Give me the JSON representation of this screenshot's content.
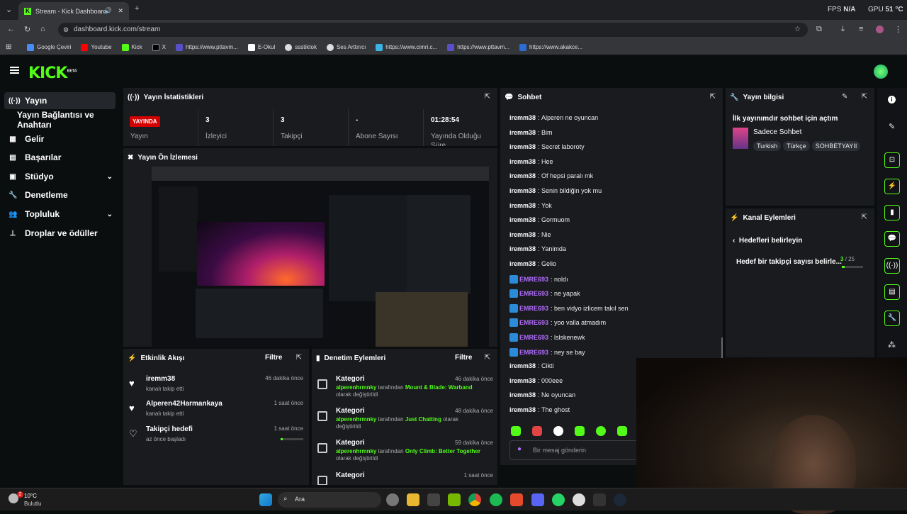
{
  "browser": {
    "tab_title": "Stream - Kick Dashboard",
    "url": "dashboard.kick.com/stream",
    "fps_label": "FPS",
    "fps_value": "N/A",
    "gpu_label": "GPU",
    "gpu_value": "51 °C",
    "bookmarks": [
      "Google Çeviri",
      "Youtube",
      "Kick",
      "X",
      "https://www.pttavm...",
      "E-Okul",
      "ssstiktok",
      "Ses Arttırıcı",
      "https://www.cimri.c...",
      "https://www.pttavm...",
      "https://www.akakce..."
    ]
  },
  "logo": {
    "text": "KICK",
    "badge": "BETA"
  },
  "sidebar": {
    "items": [
      {
        "label": "Yayın",
        "icon": "broadcast-icon"
      },
      {
        "label": "Yayın Bağlantısı ve Anahtarı",
        "icon": ""
      },
      {
        "label": "Gelir",
        "icon": "revenue-icon"
      },
      {
        "label": "Başarılar",
        "icon": "achievements-icon"
      },
      {
        "label": "Stüdyo",
        "icon": "studio-icon"
      },
      {
        "label": "Denetleme",
        "icon": "wrench-icon"
      },
      {
        "label": "Topluluk",
        "icon": "community-icon"
      },
      {
        "label": "Droplar ve ödüller",
        "icon": "drops-icon"
      }
    ]
  },
  "stats": {
    "title": "Yayın İstatistikleri",
    "live_badge": "YAYINDA",
    "live_label": "Yayın",
    "items": [
      {
        "value": "3",
        "label": "İzleyici"
      },
      {
        "value": "3",
        "label": "Takipçi"
      },
      {
        "value": "-",
        "label": "Abone Sayısı"
      },
      {
        "value": "01:28:54",
        "label": "Yayında Olduğu Süre"
      }
    ]
  },
  "preview": {
    "title": "Yayın Ön İzlemesi"
  },
  "activity": {
    "title": "Etkinlik Akışı",
    "filter": "Filtre",
    "items": [
      {
        "name": "iremm38",
        "sub": "kanalı takip etti",
        "time": "46 dakika önce"
      },
      {
        "name": "Alperen42Harmankaya",
        "sub": "kanalı takip etti",
        "time": "1 saat önce"
      },
      {
        "name": "Takipçi hedefi",
        "sub": "az önce başladı",
        "time": "1 saat önce"
      }
    ]
  },
  "moderation": {
    "title": "Denetim Eylemleri",
    "filter": "Filtre",
    "items": [
      {
        "title": "Kategori",
        "time": "46 dakika önce",
        "user": "alperenhrmnky",
        "mid": " tarafından ",
        "game": "Mount & Blade: Warband",
        "end": " olarak değiştirildi"
      },
      {
        "title": "Kategori",
        "time": "48 dakika önce",
        "user": "alperenhrmnky",
        "mid": " tarafından ",
        "game": "Just Chatting",
        "end": " olarak değiştirildi"
      },
      {
        "title": "Kategori",
        "time": "59 dakika önce",
        "user": "alperenhrmnky",
        "mid": " tarafından ",
        "game": "Only Climb: Better Together",
        "end": " olarak değiştirildi"
      },
      {
        "title": "Kategori",
        "time": "1 saat önce",
        "user": "",
        "mid": "",
        "game": "",
        "end": ""
      }
    ]
  },
  "chat": {
    "title": "Sohbet",
    "placeholder": "Bir mesaj gönderin",
    "messages": [
      {
        "user": "iremm38",
        "text": "Alperen ne oyuncan",
        "badge": false
      },
      {
        "user": "iremm38",
        "text": "Bim",
        "badge": false
      },
      {
        "user": "iremm38",
        "text": "Secret laboroty",
        "badge": false
      },
      {
        "user": "iremm38",
        "text": "Hee",
        "badge": false
      },
      {
        "user": "iremm38",
        "text": "Of hepsi paralı mk",
        "badge": false
      },
      {
        "user": "iremm38",
        "text": "Senin bildiğin yok mu",
        "badge": false
      },
      {
        "user": "iremm38",
        "text": "Yok",
        "badge": false
      },
      {
        "user": "iremm38",
        "text": "Gormuom",
        "badge": false
      },
      {
        "user": "iremm38",
        "text": "Nie",
        "badge": false
      },
      {
        "user": "iremm38",
        "text": "Yanimda",
        "badge": false
      },
      {
        "user": "iremm38",
        "text": "Gelio",
        "badge": false
      },
      {
        "user": "EMRE693",
        "text": "noldı",
        "badge": true
      },
      {
        "user": "EMRE693",
        "text": "ne yapak",
        "badge": true
      },
      {
        "user": "EMRE693",
        "text": "ben vidyo izlicem takıl sen",
        "badge": true
      },
      {
        "user": "EMRE693",
        "text": "yoo valla atmadım",
        "badge": true
      },
      {
        "user": "EMRE693",
        "text": "lslskenewk",
        "badge": true
      },
      {
        "user": "EMRE693",
        "text": "ney se bay",
        "badge": true
      },
      {
        "user": "iremm38",
        "text": "Cikti",
        "badge": false
      },
      {
        "user": "iremm38",
        "text": "000eee",
        "badge": false
      },
      {
        "user": "iremm38",
        "text": "Ne oyuncan",
        "badge": false
      },
      {
        "user": "iremm38",
        "text": "The ghost",
        "badge": false
      }
    ]
  },
  "stream_info": {
    "title": "Yayın bilgisi",
    "stream_title": "İlk yayınımdır sohbet için açtım",
    "category": "Sadece Sohbet",
    "tags": [
      "Turkish",
      "Türkçe",
      "SOHBETYAYII"
    ]
  },
  "channel_actions": {
    "title": "Kanal Eylemleri",
    "back_label": "Hedefleri belirleyin",
    "goal_label": "Hedef bir takipçi sayısı belirle...",
    "goal_current": "3",
    "goal_total": "/ 25",
    "goal_progress": 0.12
  },
  "taskbar": {
    "weather_temp": "10°C",
    "weather_desc": "Bulutlu",
    "weather_badge": "2",
    "search": "Ara"
  },
  "colors": {
    "accent": "#53fc18",
    "live": "#d40000",
    "emre": "#b36cff"
  }
}
